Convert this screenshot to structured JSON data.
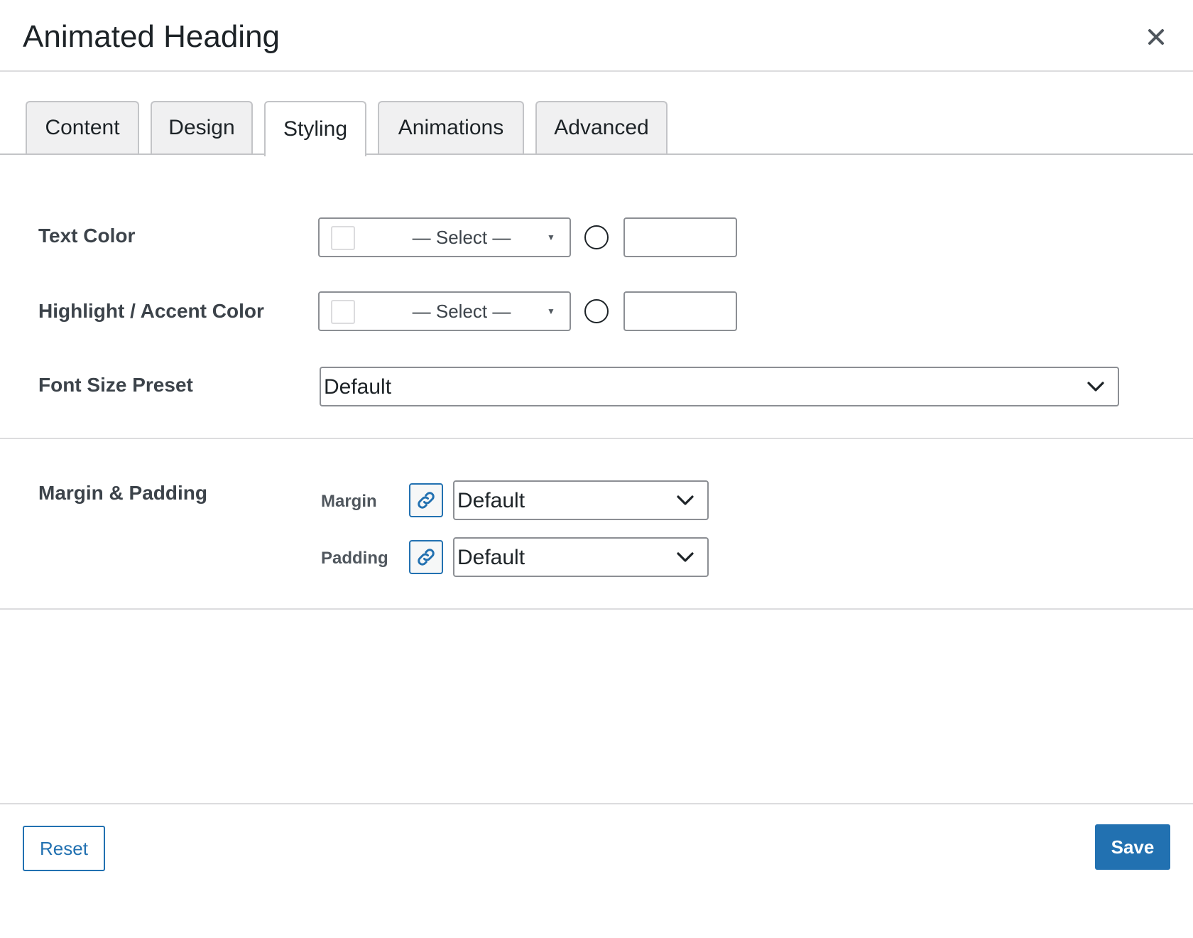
{
  "dialog": {
    "title": "Animated Heading"
  },
  "tabs": [
    {
      "label": "Content",
      "active": false
    },
    {
      "label": "Design",
      "active": false
    },
    {
      "label": "Styling",
      "active": true
    },
    {
      "label": "Animations",
      "active": false
    },
    {
      "label": "Advanced",
      "active": false
    }
  ],
  "fields": {
    "text_color": {
      "label": "Text Color",
      "select_label": "— Select —",
      "hex_value": ""
    },
    "accent_color": {
      "label": "Highlight / Accent Color",
      "select_label": "— Select —",
      "hex_value": ""
    },
    "font_size": {
      "label": "Font Size Preset",
      "value": "Default"
    },
    "spacing": {
      "label": "Margin & Padding",
      "margin_label": "Margin",
      "margin_value": "Default",
      "padding_label": "Padding",
      "padding_value": "Default"
    }
  },
  "footer": {
    "reset_label": "Reset",
    "save_label": "Save"
  },
  "colors": {
    "accent": "#2271b1",
    "text": "#1d2327",
    "border": "#8c8f94",
    "tab_bg": "#f0f0f1"
  },
  "icons": [
    "close-icon",
    "caret-down-icon",
    "chevron-down-icon",
    "link-icon"
  ]
}
